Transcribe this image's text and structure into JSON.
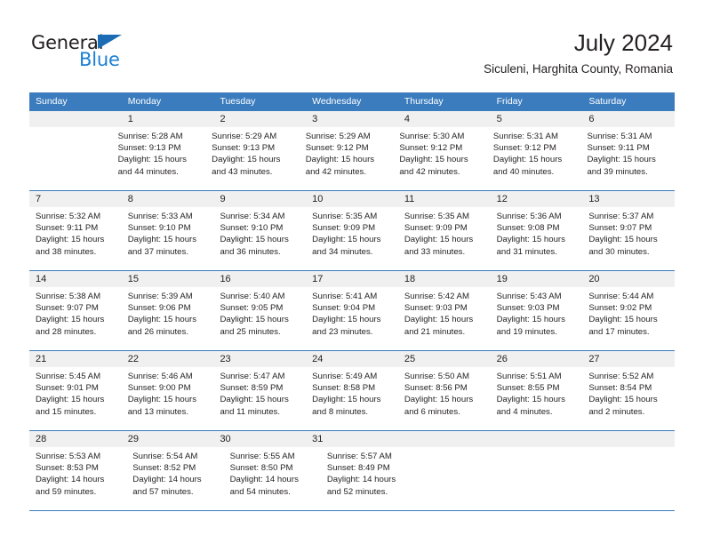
{
  "brand": {
    "name_part1": "General",
    "name_part2": "Blue",
    "accent_color": "#1b7fd4",
    "triangle_color": "#1b6cb5"
  },
  "header": {
    "title": "July 2024",
    "subtitle": "Siculeni, Harghita County, Romania"
  },
  "theme": {
    "header_blue": "#3a7cbe",
    "daynum_band": "#f0f0f0",
    "text": "#231f20"
  },
  "weekdays": [
    "Sunday",
    "Monday",
    "Tuesday",
    "Wednesday",
    "Thursday",
    "Friday",
    "Saturday"
  ],
  "weeks": [
    {
      "days": [
        {
          "num": "",
          "sunrise": "",
          "sunset": "",
          "daylight_line1": "",
          "daylight_line2": ""
        },
        {
          "num": "1",
          "sunrise": "Sunrise: 5:28 AM",
          "sunset": "Sunset: 9:13 PM",
          "daylight_line1": "Daylight: 15 hours",
          "daylight_line2": "and 44 minutes."
        },
        {
          "num": "2",
          "sunrise": "Sunrise: 5:29 AM",
          "sunset": "Sunset: 9:13 PM",
          "daylight_line1": "Daylight: 15 hours",
          "daylight_line2": "and 43 minutes."
        },
        {
          "num": "3",
          "sunrise": "Sunrise: 5:29 AM",
          "sunset": "Sunset: 9:12 PM",
          "daylight_line1": "Daylight: 15 hours",
          "daylight_line2": "and 42 minutes."
        },
        {
          "num": "4",
          "sunrise": "Sunrise: 5:30 AM",
          "sunset": "Sunset: 9:12 PM",
          "daylight_line1": "Daylight: 15 hours",
          "daylight_line2": "and 42 minutes."
        },
        {
          "num": "5",
          "sunrise": "Sunrise: 5:31 AM",
          "sunset": "Sunset: 9:12 PM",
          "daylight_line1": "Daylight: 15 hours",
          "daylight_line2": "and 40 minutes."
        },
        {
          "num": "6",
          "sunrise": "Sunrise: 5:31 AM",
          "sunset": "Sunset: 9:11 PM",
          "daylight_line1": "Daylight: 15 hours",
          "daylight_line2": "and 39 minutes."
        }
      ]
    },
    {
      "days": [
        {
          "num": "7",
          "sunrise": "Sunrise: 5:32 AM",
          "sunset": "Sunset: 9:11 PM",
          "daylight_line1": "Daylight: 15 hours",
          "daylight_line2": "and 38 minutes."
        },
        {
          "num": "8",
          "sunrise": "Sunrise: 5:33 AM",
          "sunset": "Sunset: 9:10 PM",
          "daylight_line1": "Daylight: 15 hours",
          "daylight_line2": "and 37 minutes."
        },
        {
          "num": "9",
          "sunrise": "Sunrise: 5:34 AM",
          "sunset": "Sunset: 9:10 PM",
          "daylight_line1": "Daylight: 15 hours",
          "daylight_line2": "and 36 minutes."
        },
        {
          "num": "10",
          "sunrise": "Sunrise: 5:35 AM",
          "sunset": "Sunset: 9:09 PM",
          "daylight_line1": "Daylight: 15 hours",
          "daylight_line2": "and 34 minutes."
        },
        {
          "num": "11",
          "sunrise": "Sunrise: 5:35 AM",
          "sunset": "Sunset: 9:09 PM",
          "daylight_line1": "Daylight: 15 hours",
          "daylight_line2": "and 33 minutes."
        },
        {
          "num": "12",
          "sunrise": "Sunrise: 5:36 AM",
          "sunset": "Sunset: 9:08 PM",
          "daylight_line1": "Daylight: 15 hours",
          "daylight_line2": "and 31 minutes."
        },
        {
          "num": "13",
          "sunrise": "Sunrise: 5:37 AM",
          "sunset": "Sunset: 9:07 PM",
          "daylight_line1": "Daylight: 15 hours",
          "daylight_line2": "and 30 minutes."
        }
      ]
    },
    {
      "days": [
        {
          "num": "14",
          "sunrise": "Sunrise: 5:38 AM",
          "sunset": "Sunset: 9:07 PM",
          "daylight_line1": "Daylight: 15 hours",
          "daylight_line2": "and 28 minutes."
        },
        {
          "num": "15",
          "sunrise": "Sunrise: 5:39 AM",
          "sunset": "Sunset: 9:06 PM",
          "daylight_line1": "Daylight: 15 hours",
          "daylight_line2": "and 26 minutes."
        },
        {
          "num": "16",
          "sunrise": "Sunrise: 5:40 AM",
          "sunset": "Sunset: 9:05 PM",
          "daylight_line1": "Daylight: 15 hours",
          "daylight_line2": "and 25 minutes."
        },
        {
          "num": "17",
          "sunrise": "Sunrise: 5:41 AM",
          "sunset": "Sunset: 9:04 PM",
          "daylight_line1": "Daylight: 15 hours",
          "daylight_line2": "and 23 minutes."
        },
        {
          "num": "18",
          "sunrise": "Sunrise: 5:42 AM",
          "sunset": "Sunset: 9:03 PM",
          "daylight_line1": "Daylight: 15 hours",
          "daylight_line2": "and 21 minutes."
        },
        {
          "num": "19",
          "sunrise": "Sunrise: 5:43 AM",
          "sunset": "Sunset: 9:03 PM",
          "daylight_line1": "Daylight: 15 hours",
          "daylight_line2": "and 19 minutes."
        },
        {
          "num": "20",
          "sunrise": "Sunrise: 5:44 AM",
          "sunset": "Sunset: 9:02 PM",
          "daylight_line1": "Daylight: 15 hours",
          "daylight_line2": "and 17 minutes."
        }
      ]
    },
    {
      "days": [
        {
          "num": "21",
          "sunrise": "Sunrise: 5:45 AM",
          "sunset": "Sunset: 9:01 PM",
          "daylight_line1": "Daylight: 15 hours",
          "daylight_line2": "and 15 minutes."
        },
        {
          "num": "22",
          "sunrise": "Sunrise: 5:46 AM",
          "sunset": "Sunset: 9:00 PM",
          "daylight_line1": "Daylight: 15 hours",
          "daylight_line2": "and 13 minutes."
        },
        {
          "num": "23",
          "sunrise": "Sunrise: 5:47 AM",
          "sunset": "Sunset: 8:59 PM",
          "daylight_line1": "Daylight: 15 hours",
          "daylight_line2": "and 11 minutes."
        },
        {
          "num": "24",
          "sunrise": "Sunrise: 5:49 AM",
          "sunset": "Sunset: 8:58 PM",
          "daylight_line1": "Daylight: 15 hours",
          "daylight_line2": "and 8 minutes."
        },
        {
          "num": "25",
          "sunrise": "Sunrise: 5:50 AM",
          "sunset": "Sunset: 8:56 PM",
          "daylight_line1": "Daylight: 15 hours",
          "daylight_line2": "and 6 minutes."
        },
        {
          "num": "26",
          "sunrise": "Sunrise: 5:51 AM",
          "sunset": "Sunset: 8:55 PM",
          "daylight_line1": "Daylight: 15 hours",
          "daylight_line2": "and 4 minutes."
        },
        {
          "num": "27",
          "sunrise": "Sunrise: 5:52 AM",
          "sunset": "Sunset: 8:54 PM",
          "daylight_line1": "Daylight: 15 hours",
          "daylight_line2": "and 2 minutes."
        }
      ]
    },
    {
      "days": [
        {
          "num": "28",
          "sunrise": "Sunrise: 5:53 AM",
          "sunset": "Sunset: 8:53 PM",
          "daylight_line1": "Daylight: 14 hours",
          "daylight_line2": "and 59 minutes."
        },
        {
          "num": "29",
          "sunrise": "Sunrise: 5:54 AM",
          "sunset": "Sunset: 8:52 PM",
          "daylight_line1": "Daylight: 14 hours",
          "daylight_line2": "and 57 minutes."
        },
        {
          "num": "30",
          "sunrise": "Sunrise: 5:55 AM",
          "sunset": "Sunset: 8:50 PM",
          "daylight_line1": "Daylight: 14 hours",
          "daylight_line2": "and 54 minutes."
        },
        {
          "num": "31",
          "sunrise": "Sunrise: 5:57 AM",
          "sunset": "Sunset: 8:49 PM",
          "daylight_line1": "Daylight: 14 hours",
          "daylight_line2": "and 52 minutes."
        },
        {
          "num": "",
          "sunrise": "",
          "sunset": "",
          "daylight_line1": "",
          "daylight_line2": ""
        },
        {
          "num": "",
          "sunrise": "",
          "sunset": "",
          "daylight_line1": "",
          "daylight_line2": ""
        },
        {
          "num": "",
          "sunrise": "",
          "sunset": "",
          "daylight_line1": "",
          "daylight_line2": ""
        }
      ]
    }
  ]
}
